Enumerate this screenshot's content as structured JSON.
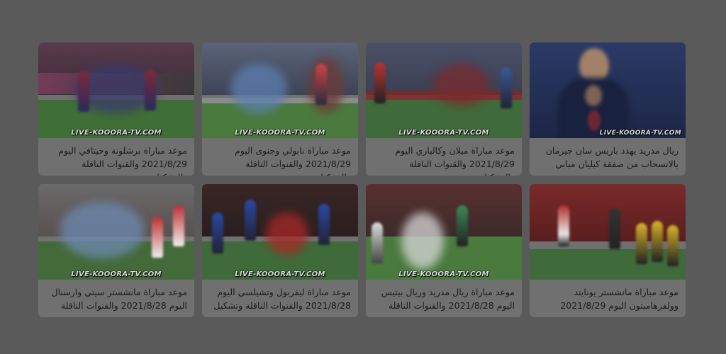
{
  "watermark": "LIVE-KOOORA-TV.COM",
  "cards": [
    {
      "title": "ريال مدريد يهدد باريس سان جيرمان بالانسحاب من صفقة كيليان مبابي"
    },
    {
      "title": "موعد مباراة ميلان وكالياري اليوم 2021/8/29 والقنوات الناقلة والتشكيل"
    },
    {
      "title": "موعد مباراة نابولي وجنوى اليوم 2021/8/29 والقنوات الناقلة والتشكيل"
    },
    {
      "title": "موعد مباراة برشلونة وخيتافي اليوم 2021/8/29 والقنوات الناقلة والتشكيل"
    },
    {
      "title": "موعد مباراة مانشستر يونايتد وولفرهامبتون اليوم 2021/8/29"
    },
    {
      "title": "موعد مباراة ريال مدريد وريال بيتيس اليوم 2021/8/28 والقنوات الناقلة"
    },
    {
      "title": "موعد مباراة ليفربول وتشيلسي اليوم 2021/8/28 والقنوات الناقلة وتشكيل"
    },
    {
      "title": "موعد مباراة مانشستر سيتي وارسنال اليوم 2021/8/28 والقنوات الناقلة"
    }
  ]
}
